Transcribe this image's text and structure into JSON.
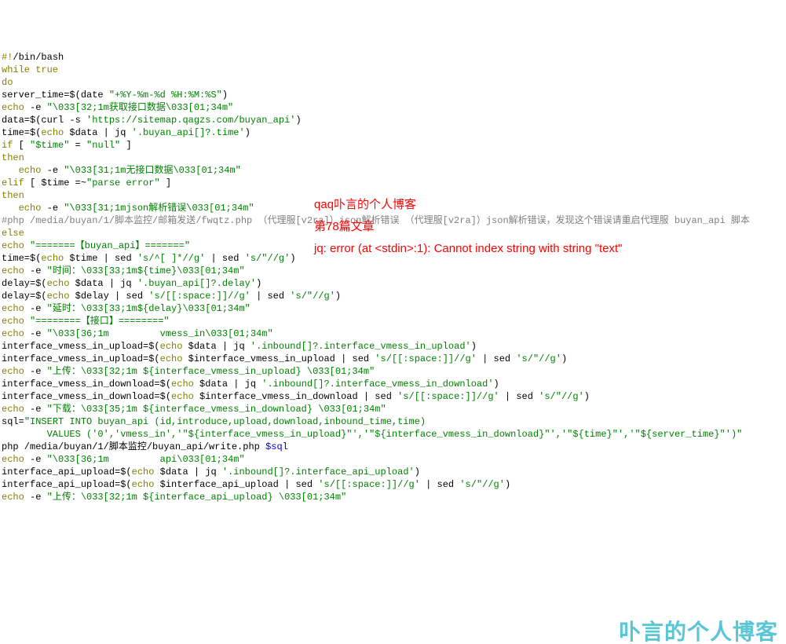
{
  "lines": [
    [
      {
        "cls": "c-olive",
        "text": "#!"
      },
      {
        "cls": "c-black",
        "text": "/bin/bash"
      }
    ],
    [
      {
        "cls": "c-olive",
        "text": "while true"
      }
    ],
    [
      {
        "cls": "c-olive",
        "text": "do"
      }
    ],
    [
      {
        "cls": "c-black",
        "text": "server_time=$(date "
      },
      {
        "cls": "c-green",
        "text": "\"+%Y-%m-%d %H:%M:%S\""
      },
      {
        "cls": "c-black",
        "text": ")"
      }
    ],
    [
      {
        "cls": "c-olive",
        "text": "echo"
      },
      {
        "cls": "c-black",
        "text": " -e "
      },
      {
        "cls": "c-green",
        "text": "\"\\033[32;1m获取接口数据\\033[01;34m\""
      }
    ],
    [
      {
        "cls": "c-black",
        "text": "data=$(curl -s "
      },
      {
        "cls": "c-green",
        "text": "'https://sitemap.qagzs.com/buyan_api'"
      },
      {
        "cls": "c-black",
        "text": ")"
      }
    ],
    [
      {
        "cls": "c-black",
        "text": "time=$("
      },
      {
        "cls": "c-olive",
        "text": "echo"
      },
      {
        "cls": "c-black",
        "text": " $data | jq "
      },
      {
        "cls": "c-green",
        "text": "'.buyan_api[]?.time'"
      },
      {
        "cls": "c-black",
        "text": ")"
      }
    ],
    [
      {
        "cls": "c-olive",
        "text": "if"
      },
      {
        "cls": "c-black",
        "text": " [ "
      },
      {
        "cls": "c-green",
        "text": "\"$time\""
      },
      {
        "cls": "c-black",
        "text": " = "
      },
      {
        "cls": "c-green",
        "text": "\"null\""
      },
      {
        "cls": "c-black",
        "text": " ]"
      }
    ],
    [
      {
        "cls": "c-olive",
        "text": "then"
      }
    ],
    [
      {
        "cls": "c-black",
        "text": "   "
      },
      {
        "cls": "c-olive",
        "text": "echo"
      },
      {
        "cls": "c-black",
        "text": " -e "
      },
      {
        "cls": "c-green",
        "text": "\"\\033[31;1m无接口数据\\033[01;34m\""
      }
    ],
    [
      {
        "cls": "c-olive",
        "text": "elif"
      },
      {
        "cls": "c-black",
        "text": " [ $time =~"
      },
      {
        "cls": "c-green",
        "text": "\"parse error\""
      },
      {
        "cls": "c-black",
        "text": " ]"
      }
    ],
    [
      {
        "cls": "c-olive",
        "text": "then"
      }
    ],
    [
      {
        "cls": "c-black",
        "text": "   "
      },
      {
        "cls": "c-olive",
        "text": "echo"
      },
      {
        "cls": "c-black",
        "text": " -e "
      },
      {
        "cls": "c-green",
        "text": "\"\\033[31;1mjson解析错误\\033[01;34m\""
      }
    ],
    [
      {
        "cls": "c-gray",
        "text": "#php /media/buyan/1/脚本监控/邮箱发送/fwqtz.php （代理服[v2ra]）json解析错误 （代理服[v2ra]）json解析错误，发现这个错误请重启代理服 buyan_api 脚本"
      }
    ],
    [
      {
        "cls": "c-olive",
        "text": "else"
      }
    ],
    [
      {
        "cls": "c-olive",
        "text": "echo"
      },
      {
        "cls": "c-black",
        "text": " "
      },
      {
        "cls": "c-green",
        "text": "\"=======【buyan_api】=======\""
      }
    ],
    [
      {
        "cls": "c-black",
        "text": "time=$("
      },
      {
        "cls": "c-olive",
        "text": "echo"
      },
      {
        "cls": "c-black",
        "text": " $time | sed "
      },
      {
        "cls": "c-green",
        "text": "'s/^[ ]*//g'"
      },
      {
        "cls": "c-black",
        "text": " | sed "
      },
      {
        "cls": "c-green",
        "text": "'s/\"//g'"
      },
      {
        "cls": "c-black",
        "text": ")"
      }
    ],
    [
      {
        "cls": "c-olive",
        "text": "echo"
      },
      {
        "cls": "c-black",
        "text": " -e "
      },
      {
        "cls": "c-green",
        "text": "\"时间：\\033[33;1m${time}\\033[01;34m\""
      }
    ],
    [
      {
        "cls": "c-black",
        "text": "delay=$("
      },
      {
        "cls": "c-olive",
        "text": "echo"
      },
      {
        "cls": "c-black",
        "text": " $data | jq "
      },
      {
        "cls": "c-green",
        "text": "'.buyan_api[]?.delay'"
      },
      {
        "cls": "c-black",
        "text": ")"
      }
    ],
    [
      {
        "cls": "c-black",
        "text": "delay=$("
      },
      {
        "cls": "c-olive",
        "text": "echo"
      },
      {
        "cls": "c-black",
        "text": " $delay | sed "
      },
      {
        "cls": "c-green",
        "text": "'s/[[:space:]]//g'"
      },
      {
        "cls": "c-black",
        "text": " | sed "
      },
      {
        "cls": "c-green",
        "text": "'s/\"//g'"
      },
      {
        "cls": "c-black",
        "text": ")"
      }
    ],
    [
      {
        "cls": "c-olive",
        "text": "echo"
      },
      {
        "cls": "c-black",
        "text": " -e "
      },
      {
        "cls": "c-green",
        "text": "\"延时：\\033[33;1m${delay}\\033[01;34m\""
      }
    ],
    [
      {
        "cls": "c-olive",
        "text": "echo"
      },
      {
        "cls": "c-black",
        "text": " "
      },
      {
        "cls": "c-green",
        "text": "\"========【接口】========\""
      }
    ],
    [
      {
        "cls": "c-olive",
        "text": "echo"
      },
      {
        "cls": "c-black",
        "text": " -e "
      },
      {
        "cls": "c-green",
        "text": "\"\\033[36;1m         vmess_in\\033[01;34m\""
      }
    ],
    [
      {
        "cls": "c-black",
        "text": "interface_vmess_in_upload=$("
      },
      {
        "cls": "c-olive",
        "text": "echo"
      },
      {
        "cls": "c-black",
        "text": " $data | jq "
      },
      {
        "cls": "c-green",
        "text": "'.inbound[]?.interface_vmess_in_upload'"
      },
      {
        "cls": "c-black",
        "text": ")"
      }
    ],
    [
      {
        "cls": "c-black",
        "text": "interface_vmess_in_upload=$("
      },
      {
        "cls": "c-olive",
        "text": "echo"
      },
      {
        "cls": "c-black",
        "text": " $interface_vmess_in_upload | sed "
      },
      {
        "cls": "c-green",
        "text": "'s/[[:space:]]//g'"
      },
      {
        "cls": "c-black",
        "text": " | sed "
      },
      {
        "cls": "c-green",
        "text": "'s/\"//g'"
      },
      {
        "cls": "c-black",
        "text": ")"
      }
    ],
    [
      {
        "cls": "c-olive",
        "text": "echo"
      },
      {
        "cls": "c-black",
        "text": " -e "
      },
      {
        "cls": "c-green",
        "text": "\"上传：\\033[32;1m ${interface_vmess_in_upload} \\033[01;34m\""
      }
    ],
    [
      {
        "cls": "c-black",
        "text": "interface_vmess_in_download=$("
      },
      {
        "cls": "c-olive",
        "text": "echo"
      },
      {
        "cls": "c-black",
        "text": " $data | jq "
      },
      {
        "cls": "c-green",
        "text": "'.inbound[]?.interface_vmess_in_download'"
      },
      {
        "cls": "c-black",
        "text": ")"
      }
    ],
    [
      {
        "cls": "c-black",
        "text": "interface_vmess_in_download=$("
      },
      {
        "cls": "c-olive",
        "text": "echo"
      },
      {
        "cls": "c-black",
        "text": " $interface_vmess_in_download | sed "
      },
      {
        "cls": "c-green",
        "text": "'s/[[:space:]]//g'"
      },
      {
        "cls": "c-black",
        "text": " | sed "
      },
      {
        "cls": "c-green",
        "text": "'s/\"//g'"
      },
      {
        "cls": "c-black",
        "text": ")"
      }
    ],
    [
      {
        "cls": "c-olive",
        "text": "echo"
      },
      {
        "cls": "c-black",
        "text": " -e "
      },
      {
        "cls": "c-green",
        "text": "\"下载：\\033[35;1m ${interface_vmess_in_download} \\033[01;34m\""
      }
    ],
    [
      {
        "cls": "c-black",
        "text": "sql="
      },
      {
        "cls": "c-green",
        "text": "\"INSERT INTO buyan_api (id,introduce,upload,download,inbound_time,time)"
      }
    ],
    [
      {
        "cls": "c-green",
        "text": "        VALUES ('0','vmess_in','\"${interface_vmess_in_upload}\"','\"${interface_vmess_in_download}\"','\"${time}\"','\"${server_time}\"')\""
      }
    ],
    [
      {
        "cls": "c-black",
        "text": "php /media/buyan/1/脚本监控/buyan_api/write.php "
      },
      {
        "cls": "c-blue",
        "text": "$sql"
      }
    ],
    [
      {
        "cls": "c-olive",
        "text": "echo"
      },
      {
        "cls": "c-black",
        "text": " -e "
      },
      {
        "cls": "c-green",
        "text": "\"\\033[36;1m         api\\033[01;34m\""
      }
    ],
    [
      {
        "cls": "c-black",
        "text": "interface_api_upload=$("
      },
      {
        "cls": "c-olive",
        "text": "echo"
      },
      {
        "cls": "c-black",
        "text": " $data | jq "
      },
      {
        "cls": "c-green",
        "text": "'.inbound[]?.interface_api_upload'"
      },
      {
        "cls": "c-black",
        "text": ")"
      }
    ],
    [
      {
        "cls": "c-black",
        "text": "interface_api_upload=$("
      },
      {
        "cls": "c-olive",
        "text": "echo"
      },
      {
        "cls": "c-black",
        "text": " $interface_api_upload | sed "
      },
      {
        "cls": "c-green",
        "text": "'s/[[:space:]]//g'"
      },
      {
        "cls": "c-black",
        "text": " | sed "
      },
      {
        "cls": "c-green",
        "text": "'s/\"//g'"
      },
      {
        "cls": "c-black",
        "text": ")"
      }
    ],
    [
      {
        "cls": "c-olive",
        "text": "echo"
      },
      {
        "cls": "c-black",
        "text": " -e "
      },
      {
        "cls": "c-green",
        "text": "\"上传：\\033[32;1m ${interface_api_upload} \\033[01;34m\""
      }
    ]
  ],
  "overlay": {
    "l1": "qaq卟言的个人博客",
    "l2": "第78篇文章",
    "l3": "jq: error (at <stdin>:1): Cannot index string with string \"text\""
  },
  "watermark": "卟言的个人博客"
}
